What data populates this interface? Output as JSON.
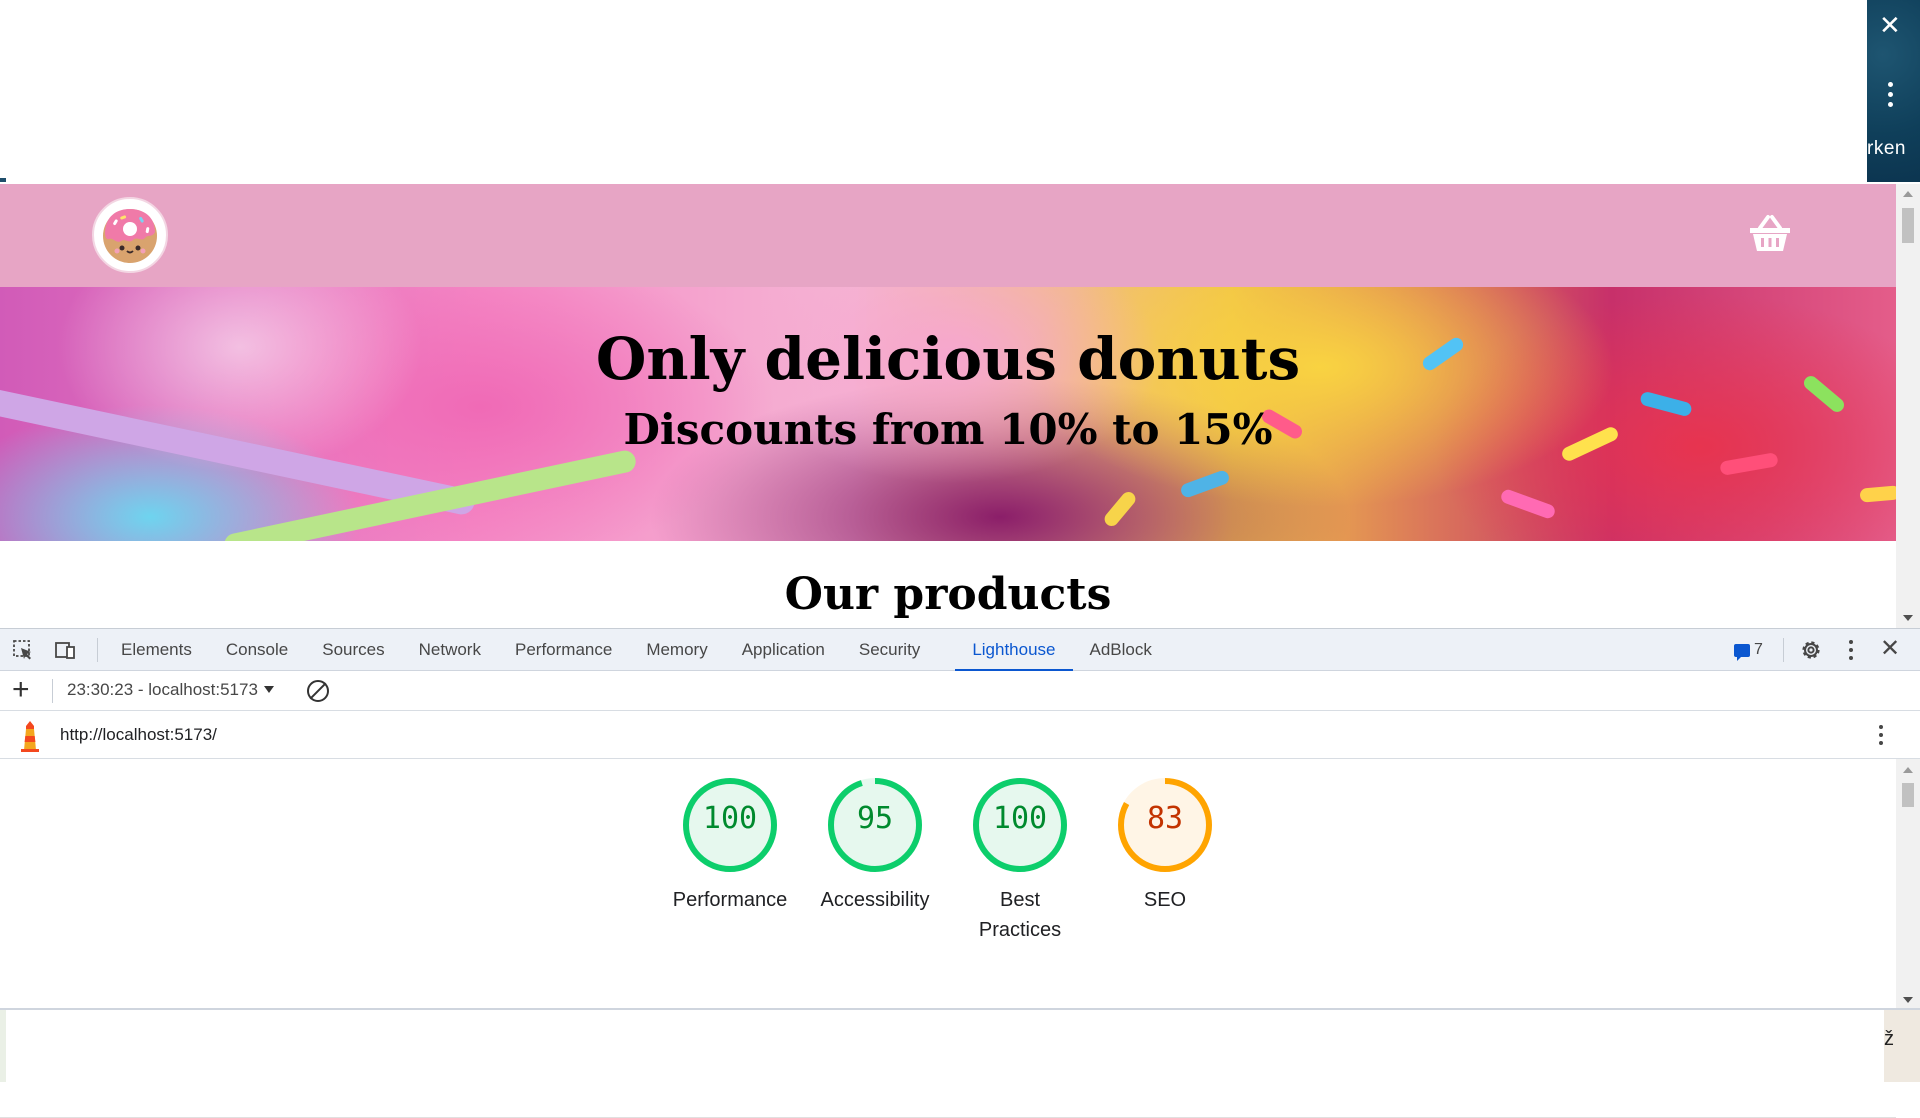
{
  "side_panel": {
    "partial_text": "rken"
  },
  "site": {
    "hero_title": "Only delicious donuts",
    "hero_subtitle": "Discounts from 10% to 15%",
    "section_title": "Our products"
  },
  "devtools": {
    "tabs": [
      "Elements",
      "Console",
      "Sources",
      "Network",
      "Performance",
      "Memory",
      "Application",
      "Security",
      "Lighthouse",
      "AdBlock"
    ],
    "active_tab": "Lighthouse",
    "issues_count": "7",
    "report_label": "23:30:23 - localhost:5173",
    "url": "http://localhost:5173/",
    "scores": [
      {
        "label": "Performance",
        "value": 100,
        "color": "#0cce6b",
        "text_color": "#008a2e",
        "bg": "#e6f8ee"
      },
      {
        "label": "Accessibility",
        "value": 95,
        "color": "#0cce6b",
        "text_color": "#008a2e",
        "bg": "#e6f8ee"
      },
      {
        "label": "Best Practices",
        "value": 100,
        "color": "#0cce6b",
        "text_color": "#008a2e",
        "bg": "#e6f8ee"
      },
      {
        "label": "SEO",
        "value": 83,
        "color": "#ffa400",
        "text_color": "#c33300",
        "bg": "#fff5e6"
      }
    ]
  },
  "bottom_right_glyph": "ž"
}
